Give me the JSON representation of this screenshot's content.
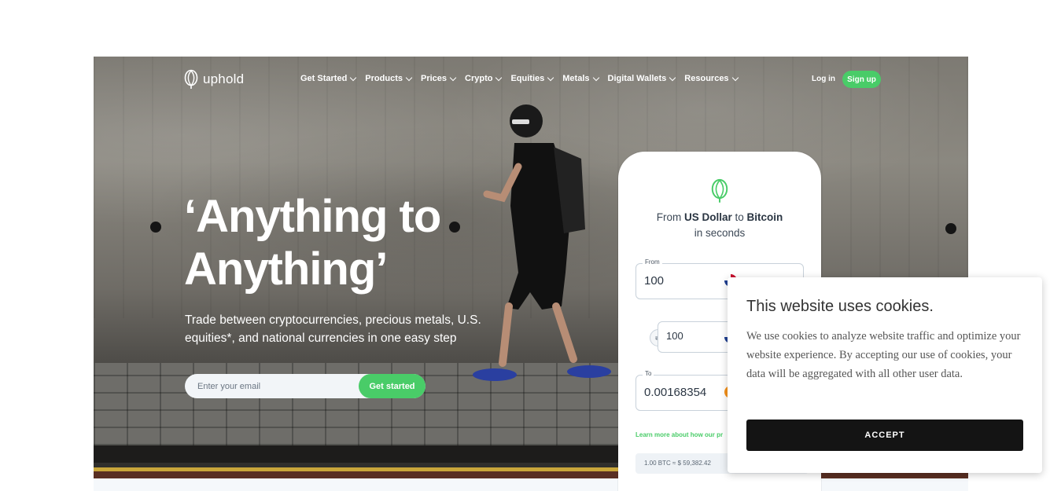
{
  "nav": {
    "logo_text": "uphold",
    "items": [
      {
        "label": "Get Started"
      },
      {
        "label": "Products"
      },
      {
        "label": "Prices"
      },
      {
        "label": "Crypto"
      },
      {
        "label": "Equities"
      },
      {
        "label": "Metals"
      },
      {
        "label": "Digital Wallets"
      },
      {
        "label": "Resources"
      }
    ],
    "login_label": "Log in",
    "signup_label": "Sign up"
  },
  "hero": {
    "headline_line1": "‘Anything to",
    "headline_line2": "Anything’",
    "subtitle": "Trade between cryptocurrencies, precious metals, U.S. equities*, and national currencies in one easy step",
    "email_placeholder": "Enter your email",
    "cta_label": "Get started"
  },
  "widget": {
    "title_from": "From",
    "title_from_currency": "US Dollar",
    "title_to": "to",
    "title_to_currency": "Bitcoin",
    "title_line2": "in seconds",
    "from_label": "From",
    "from_value": "100",
    "mid_value": "100",
    "to_label": "To",
    "to_value": "0.00168354",
    "learn_more": "Learn more about how our pr",
    "rate": "1.00 BTC ≈ $ 59,382.42"
  },
  "cookie": {
    "title": "This website uses cookies.",
    "body": "We use cookies to analyze website traffic and optimize your website experience. By accepting our use of cookies, your data will be aggregated with all other user data.",
    "accept_label": "ACCEPT"
  },
  "colors": {
    "brand_green": "#49cc68",
    "cookie_button": "#141414"
  }
}
